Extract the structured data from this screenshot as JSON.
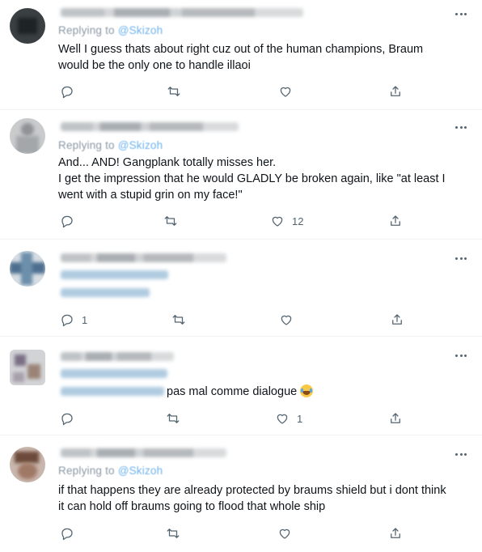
{
  "tweets": [
    {
      "reply_prefix": "Replying to",
      "reply_handle": "@Skizoh",
      "body": [
        "Well I guess thats about right cuz out of the human champions, Braum",
        "would be the only one to handle illaoi"
      ],
      "reply_count": "",
      "retweet_count": "",
      "like_count": ""
    },
    {
      "reply_prefix": "Replying to",
      "reply_handle": "@Skizoh",
      "body": [
        "And... AND! Gangplank totally misses her.",
        "I get the impression that he would GLADLY be broken again, like \"at least I",
        "went with a stupid grin on my face!\""
      ],
      "reply_count": "",
      "retweet_count": "",
      "like_count": "12"
    },
    {
      "body": [],
      "reply_count": "1",
      "retweet_count": "",
      "like_count": ""
    },
    {
      "body_text": "pas mal comme dialogue",
      "reply_count": "",
      "retweet_count": "",
      "like_count": "1"
    },
    {
      "reply_prefix": "Replying to",
      "reply_handle": "@Skizoh",
      "body": [
        "if that happens they are already protected by braums shield but i dont think",
        "it can hold off braums going to flood that whole ship"
      ],
      "reply_count": "",
      "retweet_count": "",
      "like_count": ""
    }
  ],
  "icons": {
    "reply": "reply-icon",
    "retweet": "retweet-icon",
    "like": "like-icon",
    "share": "share-icon",
    "more": "more-icon",
    "emoji": "grinning-sweat-emoji"
  },
  "colors": {
    "text": "#0f1419",
    "secondary": "#536471",
    "link": "#1d9bf0",
    "divider": "#eff3f4"
  }
}
